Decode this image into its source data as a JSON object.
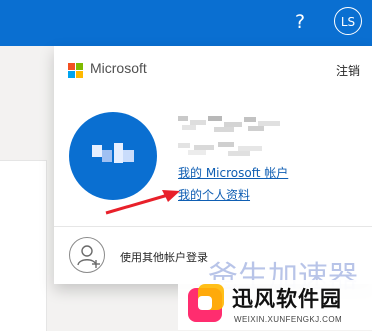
{
  "topbar": {
    "help_icon": "?",
    "user_initials": "LS",
    "colors": {
      "bar": "#0a6fd1"
    }
  },
  "account_panel": {
    "brand": "Microsoft",
    "sign_out": "注销",
    "links": {
      "microsoft_account": "我的 Microsoft 帐户",
      "profile": "我的个人资料"
    },
    "other_account": "使用其他帐户登录"
  },
  "watermark": {
    "top_text": "爸生加速器",
    "title": "迅风软件园",
    "url": "WEIXIN.XUNFENGKJ.COM"
  },
  "colors": {
    "link": "#0f5eb3",
    "annotation_arrow": "#e8202a"
  }
}
